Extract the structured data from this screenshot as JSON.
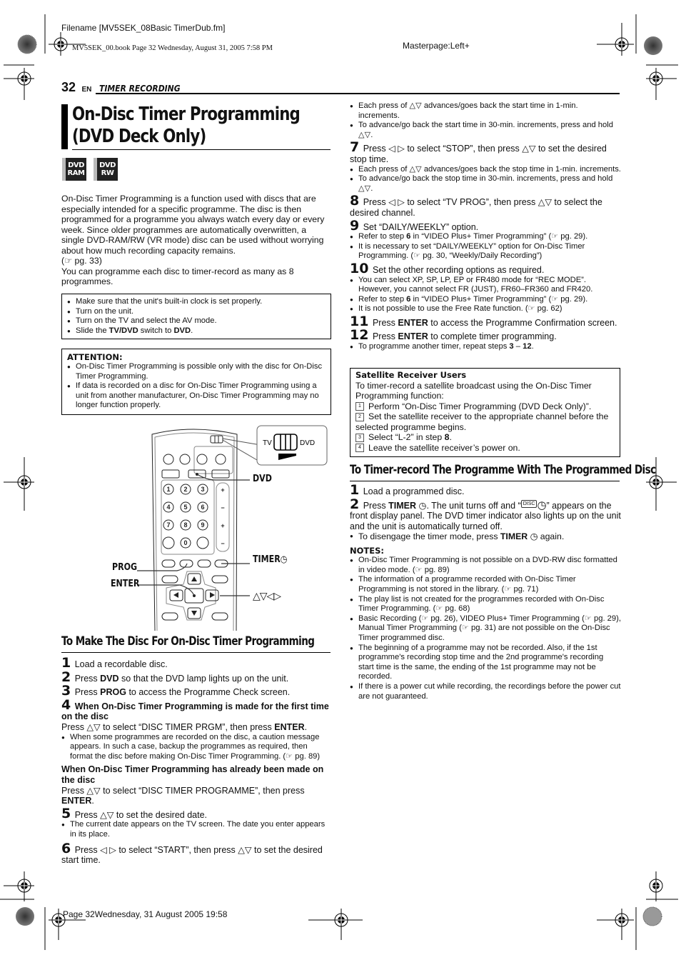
{
  "print_marks": {
    "filename": "Filename [MV5SEK_08Basic TimerDub.fm]",
    "book_line": "MV5SEK_00.book  Page 32  Wednesday, August 31, 2005  7:58 PM",
    "masterpage": "Masterpage:Left+",
    "footer_line": "Page 32Wednesday, 31 August 2005  19:58"
  },
  "header": {
    "page_number": "32",
    "lang": "EN",
    "section": "TIMER RECORDING"
  },
  "title": "On-Disc Timer Programming (DVD Deck Only)",
  "badges": [
    {
      "line1": "DVD",
      "line2": "RAM"
    },
    {
      "line1": "DVD",
      "line2": "RW"
    }
  ],
  "intro": {
    "paragraph1": "On-Disc Timer Programming is a function used with discs that are especially intended for a specific programme. The disc is then programmed for a programme you always watch every day or every week. Since older programmes are automatically overwritten, a single DVD-RAM/RW (VR mode) disc can be used without worrying about how much recording capacity remains.",
    "ref1": "(☞ pg. 33)",
    "paragraph2": "You can programme each disc to timer-record as many as 8 programmes."
  },
  "prep_box": {
    "items": [
      "Make sure that the unit's built-in clock is set properly.",
      "Turn on the unit.",
      "Turn on the TV and select the AV mode."
    ],
    "last_item": {
      "pre": "Slide the ",
      "bold1": "TV/DVD",
      "mid": " switch to ",
      "bold2": "DVD",
      "post": "."
    }
  },
  "attention_box": {
    "title": "ATTENTION:",
    "items": [
      "On-Disc Timer Programming is possible only with the disc for On-Disc Timer Programming.",
      "If data is recorded on a disc for On-Disc Timer Programming using a unit from another manufacturer, On-Disc Timer Programming may no longer function properly."
    ]
  },
  "remote_figure": {
    "switch_left": "TV",
    "switch_right": "DVD",
    "callout_dvd": "DVD",
    "callout_timer": "TIMER",
    "callout_prog": "PROG",
    "callout_enter": "ENTER",
    "callout_arrows": "△▽◁▷",
    "keypad": [
      "1",
      "2",
      "3",
      "4",
      "5",
      "6",
      "7",
      "8",
      "9",
      "0"
    ]
  },
  "section1": {
    "heading": "To Make The Disc For On-Disc Timer Programming",
    "step1": {
      "num": "1",
      "text": "Load a recordable disc."
    },
    "step2": {
      "num": "2",
      "pre": "Press ",
      "bold": "DVD",
      "post": " so that the DVD lamp lights up on the unit."
    },
    "step3": {
      "num": "3",
      "pre": "Press ",
      "bold": "PROG",
      "post": " to access the Programme Check screen."
    },
    "step4": {
      "num": "4",
      "heading": "When On-Disc Timer Programming is made for the first time on the disc",
      "text_pre": "Press △▽ to select “DISC TIMER PRGM”, then press ",
      "text_bold": "ENTER",
      "text_post": ".",
      "bullet": "When some programmes are recorded on the disc, a caution message appears. In such a case, backup the programmes as required, then format the disc before making On-Disc Timer Programming. (☞ pg. 89)",
      "alt_heading": "When On-Disc Timer Programming has already been made on the disc",
      "alt_text_pre": "Press △▽ to select “DISC TIMER PROGRAMME”, then press ",
      "alt_text_bold": "ENTER",
      "alt_text_post": "."
    },
    "step5": {
      "num": "5",
      "text": "Press △▽ to set the desired date.",
      "bullet": "The current date appears on the TV screen. The date you enter appears in its place."
    },
    "step6": {
      "num": "6",
      "text": "Press ◁ ▷ to select “START”, then press △▽ to set the desired start time."
    }
  },
  "right_column": {
    "step6_bullets": [
      "Each press of △▽ advances/goes back the start time in 1-min. increments.",
      "To advance/go back the start time in 30-min. increments, press and hold △▽."
    ],
    "step7": {
      "num": "7",
      "text": "Press ◁ ▷ to select “STOP”, then press △▽ to set the desired stop time.",
      "bullets": [
        "Each press of △▽ advances/goes back the stop time in 1-min. increments.",
        "To advance/go back the stop time in 30-min. increments, press and hold △▽."
      ]
    },
    "step8": {
      "num": "8",
      "text": "Press ◁ ▷ to select “TV PROG”, then press △▽ to select the desired channel."
    },
    "step9": {
      "num": "9",
      "text": "Set “DAILY/WEEKLY” option.",
      "bullet1": {
        "pre": "Refer to step ",
        "bold": "6",
        "post": " in “VIDEO Plus+ Timer Programming” (☞ pg. 29)."
      },
      "bullet2": "It is necessary to set “DAILY/WEEKLY” option for On-Disc Timer Programming. (☞ pg. 30, “Weekly/Daily Recording”)"
    },
    "step10": {
      "num": "10",
      "text": "Set the other recording options as required.",
      "bullet1": "You can select XP, SP, LP, EP or FR480 mode for “REC MODE”. However, you cannot select FR (JUST), FR60–FR360 and FR420.",
      "bullet2": {
        "pre": "Refer to step ",
        "bold": "6",
        "post": " in “VIDEO Plus+ Timer Programming” (☞ pg. 29)."
      },
      "bullet3": "It is not possible to use the Free Rate function. (☞ pg. 62)"
    },
    "step11": {
      "num": "11",
      "pre": "Press ",
      "bold": "ENTER",
      "post": " to access the Programme Confirmation screen."
    },
    "step12": {
      "num": "12",
      "pre": "Press ",
      "bold": "ENTER",
      "post": " to complete timer programming.",
      "bullet": {
        "pre": "To programme another timer, repeat steps ",
        "b1": "3",
        "mid": " – ",
        "b2": "12",
        "post": "."
      }
    }
  },
  "satellite_box": {
    "title": "Satellite Receiver Users",
    "intro": "To timer-record a satellite broadcast using the On-Disc Timer Programming function:",
    "items": [
      {
        "n": "1",
        "text": "Perform “On-Disc Timer Programming (DVD Deck Only)”."
      },
      {
        "n": "2",
        "text": "Set the satellite receiver to the appropriate channel before the selected programme begins."
      },
      {
        "n": "3",
        "pre": "Select “L-2” in step ",
        "bold": "8",
        "post": "."
      },
      {
        "n": "4",
        "text": "Leave the satellite receiver’s power on."
      }
    ]
  },
  "section2": {
    "heading": "To Timer-record The Programme With The Programmed Disc",
    "step1": {
      "num": "1",
      "text": "Load a programmed disc."
    },
    "step2": {
      "num": "2",
      "pre": "Press ",
      "bold": "TIMER",
      "mid": ". The unit turns off and “",
      "disc_icon_text": "DISC",
      "post": "” appears on the front display panel. The DVD timer indicator also lights up on the unit and the unit is automatically turned off."
    },
    "bullet": {
      "pre": "To disengage the timer mode, press ",
      "bold": "TIMER",
      "post": " again."
    }
  },
  "notes": {
    "title": "NOTES:",
    "items": [
      "On-Disc Timer Programming is not possible on a DVD-RW disc formatted in video mode. (☞ pg. 89)",
      "The information of a programme recorded with On-Disc Timer Programming is not stored in the library. (☞ pg. 71)",
      "The play list is not created for the programmes recorded with On-Disc Timer Programming. (☞ pg. 68)",
      "Basic Recording (☞ pg. 26), VIDEO Plus+ Timer Programming (☞ pg. 29), Manual Timer Programming (☞ pg. 31) are not possible on the On-Disc Timer programmed disc.",
      "The beginning of a programme may not be recorded. Also, if the 1st programme's recording stop time and the 2nd programme's recording start time is the same, the ending of the 1st programme may not be recorded.",
      "If there is a power cut while recording, the recordings before the power cut are not guaranteed."
    ]
  }
}
